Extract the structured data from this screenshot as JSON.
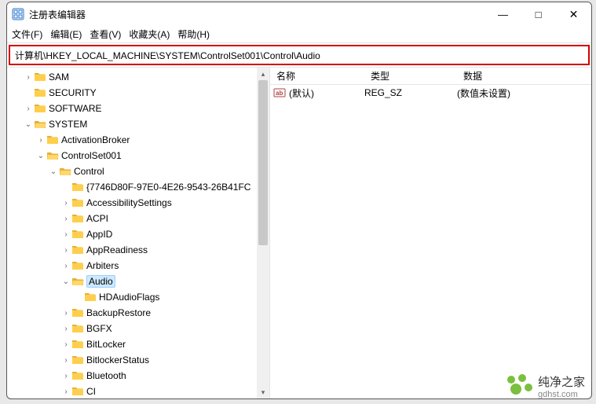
{
  "window": {
    "title": "注册表编辑器"
  },
  "wincontrols": {
    "min": "—",
    "max": "□",
    "close": "✕"
  },
  "menu": {
    "file": "文件(F)",
    "edit": "编辑(E)",
    "view": "查看(V)",
    "favorites": "收藏夹(A)",
    "help": "帮助(H)"
  },
  "address": {
    "value": "计算机\\HKEY_LOCAL_MACHINE\\SYSTEM\\ControlSet001\\Control\\Audio"
  },
  "tree": {
    "items": [
      {
        "depth": 1,
        "exp": "›",
        "open": false,
        "label": "SAM"
      },
      {
        "depth": 1,
        "exp": "",
        "open": false,
        "label": "SECURITY"
      },
      {
        "depth": 1,
        "exp": "›",
        "open": false,
        "label": "SOFTWARE"
      },
      {
        "depth": 1,
        "exp": "⌄",
        "open": true,
        "label": "SYSTEM"
      },
      {
        "depth": 2,
        "exp": "›",
        "open": false,
        "label": "ActivationBroker"
      },
      {
        "depth": 2,
        "exp": "⌄",
        "open": true,
        "label": "ControlSet001"
      },
      {
        "depth": 3,
        "exp": "⌄",
        "open": true,
        "label": "Control"
      },
      {
        "depth": 4,
        "exp": "",
        "open": false,
        "label": "{7746D80F-97E0-4E26-9543-26B41FC"
      },
      {
        "depth": 4,
        "exp": "›",
        "open": false,
        "label": "AccessibilitySettings"
      },
      {
        "depth": 4,
        "exp": "›",
        "open": false,
        "label": "ACPI"
      },
      {
        "depth": 4,
        "exp": "›",
        "open": false,
        "label": "AppID"
      },
      {
        "depth": 4,
        "exp": "›",
        "open": false,
        "label": "AppReadiness"
      },
      {
        "depth": 4,
        "exp": "›",
        "open": false,
        "label": "Arbiters"
      },
      {
        "depth": 4,
        "exp": "⌄",
        "open": true,
        "label": "Audio",
        "selected": true
      },
      {
        "depth": 5,
        "exp": "",
        "open": false,
        "label": "HDAudioFlags"
      },
      {
        "depth": 4,
        "exp": "›",
        "open": false,
        "label": "BackupRestore"
      },
      {
        "depth": 4,
        "exp": "›",
        "open": false,
        "label": "BGFX"
      },
      {
        "depth": 4,
        "exp": "›",
        "open": false,
        "label": "BitLocker"
      },
      {
        "depth": 4,
        "exp": "›",
        "open": false,
        "label": "BitlockerStatus"
      },
      {
        "depth": 4,
        "exp": "›",
        "open": false,
        "label": "Bluetooth"
      },
      {
        "depth": 4,
        "exp": "›",
        "open": false,
        "label": "CI"
      }
    ]
  },
  "list": {
    "cols": {
      "name": "名称",
      "type": "类型",
      "data": "数据"
    },
    "rows": [
      {
        "icon": "ab",
        "name": "(默认)",
        "type": "REG_SZ",
        "data": "(数值未设置)"
      }
    ]
  },
  "watermark": {
    "line1": "纯净之家",
    "line2": "gdhst.com"
  }
}
